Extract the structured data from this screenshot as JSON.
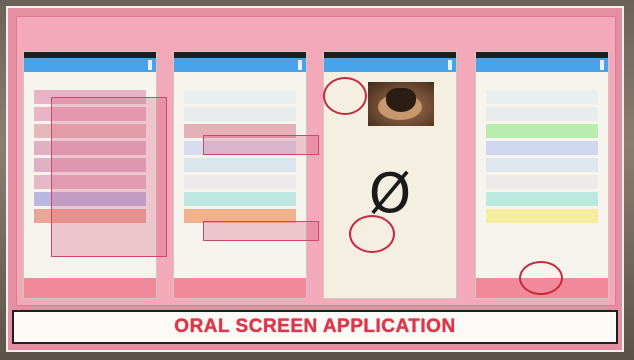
{
  "caption": "ORAL SCREEN APPLICATION",
  "screens": [
    {
      "title": "",
      "hint": "",
      "rows": [
        {
          "label": "",
          "color": "#e8b4c6"
        },
        {
          "label": "",
          "color": "#e8b4c6"
        },
        {
          "label": "",
          "color": "#e6b8bc"
        },
        {
          "label": "",
          "color": "#e2b0c4"
        },
        {
          "label": "",
          "color": "#e2b0c4"
        },
        {
          "label": "",
          "color": "#e6b8c8"
        },
        {
          "label": "",
          "color": "#b9b6e0"
        },
        {
          "label": "",
          "color": "#eaa894"
        }
      ],
      "button": ""
    },
    {
      "title": "",
      "hint": "",
      "rows": [
        {
          "label": "",
          "color": "#e9eeee"
        },
        {
          "label": "",
          "color": "#e8ecec"
        },
        {
          "label": "",
          "color": "#e6b0b8"
        },
        {
          "label": "",
          "color": "#d8dcf0"
        },
        {
          "label": "",
          "color": "#d9e6ee"
        },
        {
          "label": "",
          "color": "#eceaea"
        },
        {
          "label": "",
          "color": "#bfe7e2"
        },
        {
          "label": "",
          "color": "#f2b08e"
        }
      ],
      "button": ""
    },
    {
      "title": "",
      "photo_label": "",
      "result_label": "",
      "symbol": "Ø",
      "left_button": "",
      "right_button": "",
      "colors": {
        "bg": "#f4efe0"
      }
    },
    {
      "title": "",
      "hint": "",
      "rows": [
        {
          "label": "",
          "color": "#e9eeee"
        },
        {
          "label": "",
          "color": "#e8ecec"
        },
        {
          "label": "",
          "color": "#b9ecb0"
        },
        {
          "label": "",
          "color": "#cfd7ef"
        },
        {
          "label": "",
          "color": "#dde7ef"
        },
        {
          "label": "",
          "color": "#ecebe8"
        },
        {
          "label": "",
          "color": "#b9e9df"
        },
        {
          "label": "",
          "color": "#f4ec9e"
        }
      ],
      "button": ""
    }
  ]
}
